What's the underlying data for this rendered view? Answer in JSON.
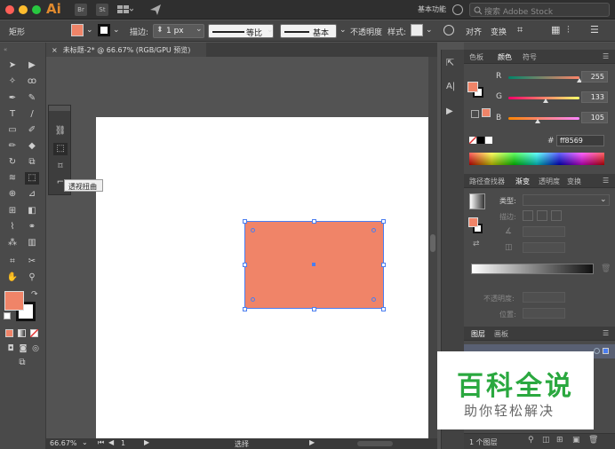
{
  "app": {
    "logo": "Ai",
    "icon_br": "Br",
    "icon_st": "St",
    "workspace": "基本功能",
    "search_placeholder": "搜索 Adobe Stock"
  },
  "colors": {
    "fill": "#f08468",
    "selection": "#4a7df0",
    "wm_green": "#2aa83f"
  },
  "control_bar": {
    "tool_name": "矩形",
    "stroke_label": "描边:",
    "stroke_value": "1 px",
    "profile_label": "等比",
    "brush_label": "基本",
    "opacity_label": "不透明度",
    "style_label": "样式:",
    "align_label": "对齐",
    "transform_label": "变换"
  },
  "document": {
    "tab_title": "未标题-2* @ 66.67% (RGB/GPU 预览)"
  },
  "tooltip": "透视扭曲",
  "status": {
    "zoom": "66.67%",
    "page": "1",
    "mode": "选择"
  },
  "color_panel": {
    "tabs": [
      "色板",
      "颜色",
      "符号"
    ],
    "r_label": "R",
    "g_label": "G",
    "b_label": "B",
    "r": "255",
    "g": "133",
    "b": "105",
    "r_level": 1.0,
    "g_level": 0.52,
    "b_level": 0.41,
    "hex_label": "#",
    "hex": "ff8569"
  },
  "gradient_panel": {
    "tabs": [
      "路径查找器",
      "渐变",
      "透明度",
      "变换"
    ],
    "type_label": "类型:",
    "stroke_label": "描边:",
    "opacity_label": "不透明度:",
    "position_label": "位置:"
  },
  "layers_panel": {
    "tabs": [
      "图层",
      "画板"
    ],
    "layer_count": "1 个图层"
  },
  "watermark": {
    "title": "百科全说",
    "subtitle": "助你轻松解决"
  }
}
